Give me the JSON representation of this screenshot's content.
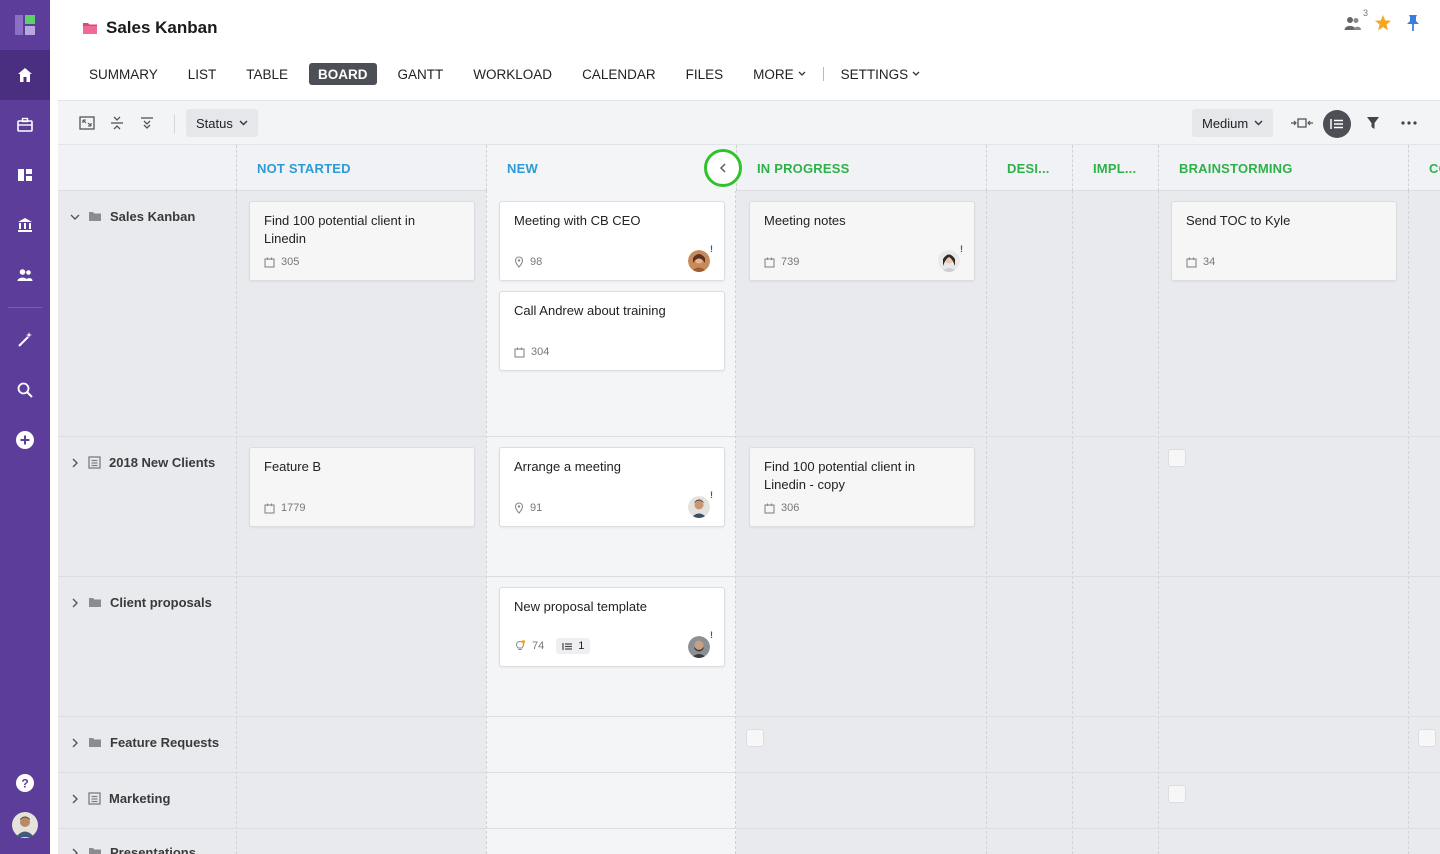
{
  "app": {
    "title": "Sales Kanban",
    "followers_count": "3"
  },
  "colors": {
    "sidebar": "#5c3d99",
    "not_started": "#2e9ad6",
    "new": "#2e9ad6",
    "in_progress": "#2fb14a",
    "highlight": "#2fc22a",
    "star": "#f5a623",
    "pin": "#3b7ddd"
  },
  "sidebar": {
    "items": [
      {
        "name": "home-icon"
      },
      {
        "name": "briefcase-icon"
      },
      {
        "name": "dashboard-icon"
      },
      {
        "name": "bank-icon"
      },
      {
        "name": "people-icon"
      },
      {
        "name": "magic-wand-icon"
      },
      {
        "name": "search-icon"
      },
      {
        "name": "add-icon"
      },
      {
        "name": "help-icon"
      }
    ]
  },
  "tabs": {
    "summary": "SUMMARY",
    "list": "LIST",
    "table": "TABLE",
    "board": "BOARD",
    "gantt": "GANTT",
    "workload": "WORKLOAD",
    "calendar": "CALENDAR",
    "files": "FILES",
    "more": "MORE",
    "settings": "SETTINGS"
  },
  "toolbar": {
    "group_by": "Status",
    "card_size": "Medium"
  },
  "columns": {
    "not_started": "NOT STARTED",
    "new": "NEW",
    "in_progress": "IN PROGRESS",
    "design": "DESI...",
    "implementation": "IMPL...",
    "brainstorming": "BRAINSTORMING",
    "next": "CO"
  },
  "groups": {
    "g1": "Sales Kanban",
    "g2": "2018 New Clients",
    "g3": "Client proposals",
    "g4": "Feature Requests",
    "g5": "Marketing",
    "g6": "Presentations"
  },
  "cards": {
    "c1": {
      "title": "Find 100 potential client in Linedin",
      "id": "305"
    },
    "c2": {
      "title": "Meeting with CB CEO",
      "id": "98"
    },
    "c3": {
      "title": "Call Andrew about training",
      "id": "304"
    },
    "c4": {
      "title": "Meeting notes",
      "id": "739"
    },
    "c5": {
      "title": "Send TOC to Kyle",
      "id": "34"
    },
    "c6": {
      "title": "Feature B",
      "id": "1779"
    },
    "c7": {
      "title": "Arrange a meeting",
      "id": "91"
    },
    "c8": {
      "title": "Find 100 potential client in Linedin - copy",
      "id": "306"
    },
    "c9": {
      "title": "New proposal template",
      "id": "74",
      "subtasks": "1"
    }
  },
  "markers": {
    "priority": "!"
  }
}
